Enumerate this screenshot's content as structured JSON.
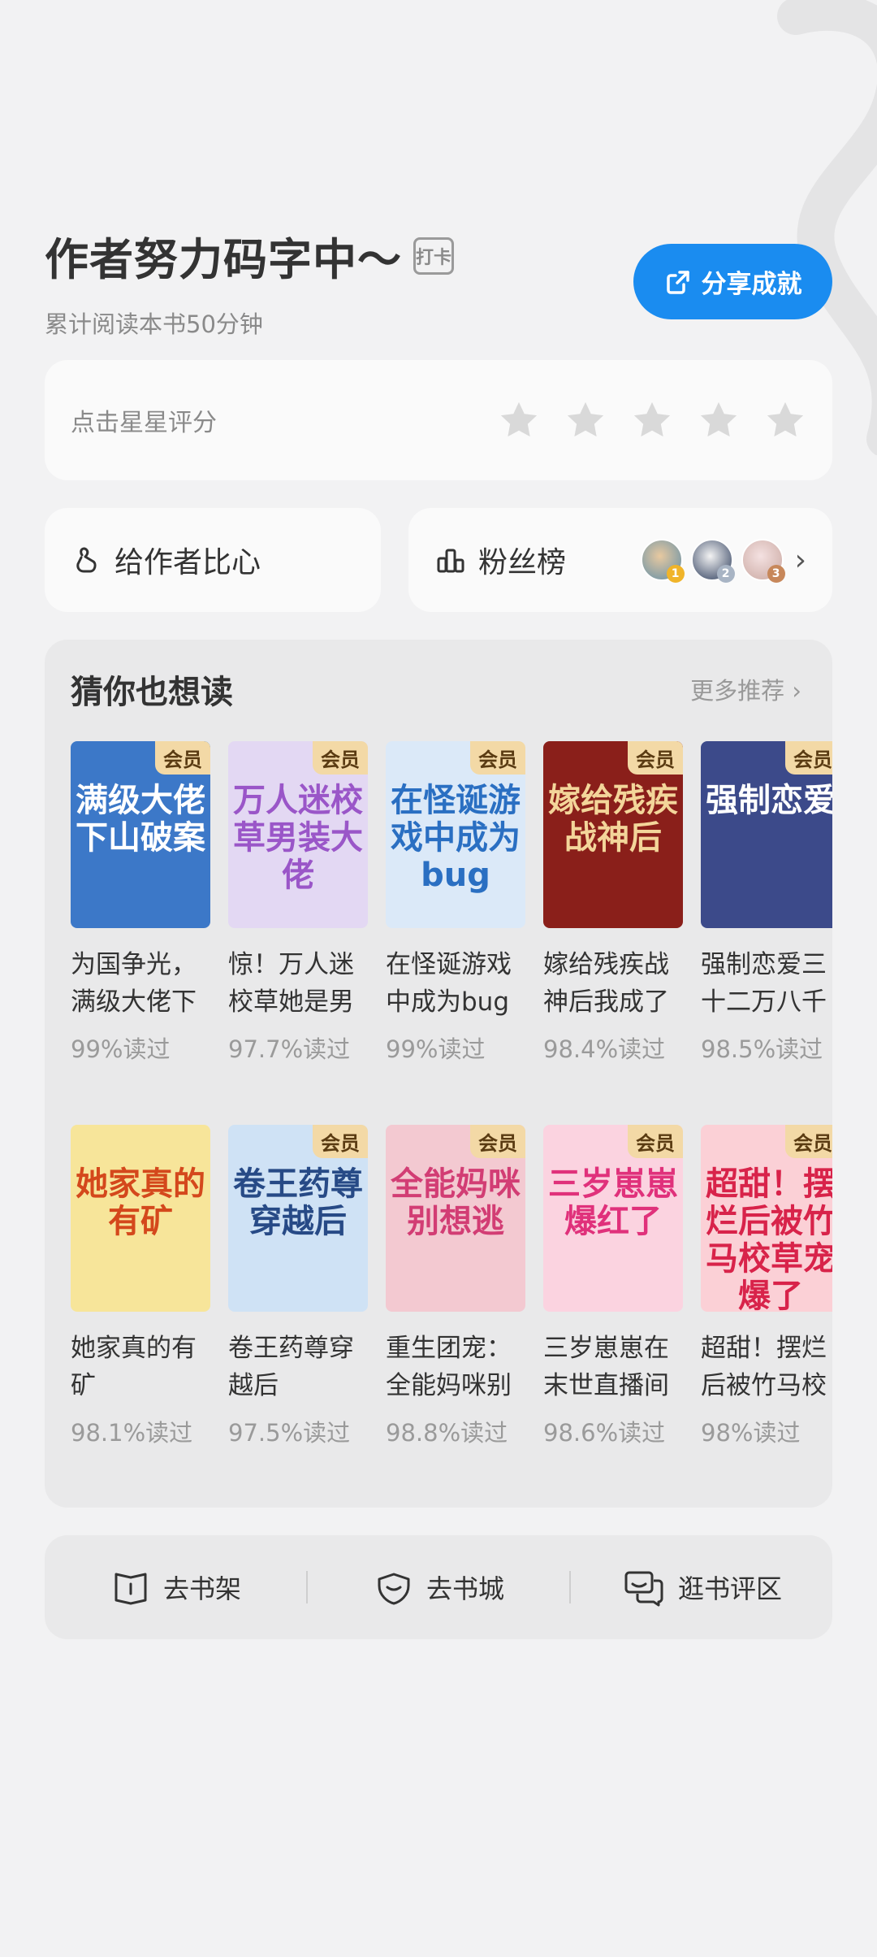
{
  "header": {
    "title": "作者努力码字中～",
    "checkin_badge": "打卡",
    "subtitle": "累计阅读本书50分钟",
    "share_label": "分享成就"
  },
  "rating": {
    "label": "点击星星评分",
    "max_stars": 5,
    "filled": 0
  },
  "tip": {
    "label": "给作者比心"
  },
  "fans": {
    "label": "粉丝榜",
    "ranks": [
      "1",
      "2",
      "3"
    ]
  },
  "recommend": {
    "title": "猜你也想读",
    "more_label": "更多推荐",
    "vip_label": "会员",
    "rows": [
      [
        {
          "name": "为国争光，满级大佬下",
          "read": "99%读过",
          "cover_text": "满级大佬下山破案",
          "bg": "#3c78c8",
          "fg": "#ffffff",
          "vip": true
        },
        {
          "name": "惊！万人迷校草她是男",
          "read": "97.7%读过",
          "cover_text": "万人迷校草男装大佬",
          "bg": "#e3d8f3",
          "fg": "#9a56c8",
          "vip": true
        },
        {
          "name": "在怪诞游戏中成为bug",
          "read": "99%读过",
          "cover_text": "在怪诞游戏中成为bug",
          "bg": "#dbe9f8",
          "fg": "#2a6fc2",
          "vip": true
        },
        {
          "name": "嫁给残疾战神后我成了",
          "read": "98.4%读过",
          "cover_text": "嫁给残疾战神后",
          "bg": "#8a1f1a",
          "fg": "#f3d59a",
          "vip": true
        },
        {
          "name": "强制恋爱三十二万八千",
          "read": "98.5%读过",
          "cover_text": "强制恋爱",
          "bg": "#3c4a8a",
          "fg": "#ffffff",
          "vip": true
        }
      ],
      [
        {
          "name": "她家真的有矿",
          "read": "98.1%读过",
          "cover_text": "她家真的有矿",
          "bg": "#f7e59a",
          "fg": "#d4481c",
          "vip": false
        },
        {
          "name": "卷王药尊穿越后",
          "read": "97.5%读过",
          "cover_text": "卷王药尊穿越后",
          "bg": "#cfe2f5",
          "fg": "#274a86",
          "vip": true
        },
        {
          "name": "重生团宠：全能妈咪别",
          "read": "98.8%读过",
          "cover_text": "全能妈咪别想逃",
          "bg": "#f3c9d1",
          "fg": "#d23d74",
          "vip": true
        },
        {
          "name": "三岁崽崽在末世直播间",
          "read": "98.6%读过",
          "cover_text": "三岁崽崽爆红了",
          "bg": "#fbd3e0",
          "fg": "#e0317b",
          "vip": true
        },
        {
          "name": "超甜！摆烂后被竹马校",
          "read": "98%读过",
          "cover_text": "超甜！摆烂后被竹马校草宠爆了",
          "bg": "#fbd0d6",
          "fg": "#d8234a",
          "vip": true
        }
      ]
    ]
  },
  "bottom_nav": {
    "shelf": "去书架",
    "store": "去书城",
    "comments": "逛书评区"
  },
  "colors": {
    "accent": "#1a8cf0",
    "vip_bg": "#f3d9a6",
    "vip_fg": "#5a3b12"
  }
}
